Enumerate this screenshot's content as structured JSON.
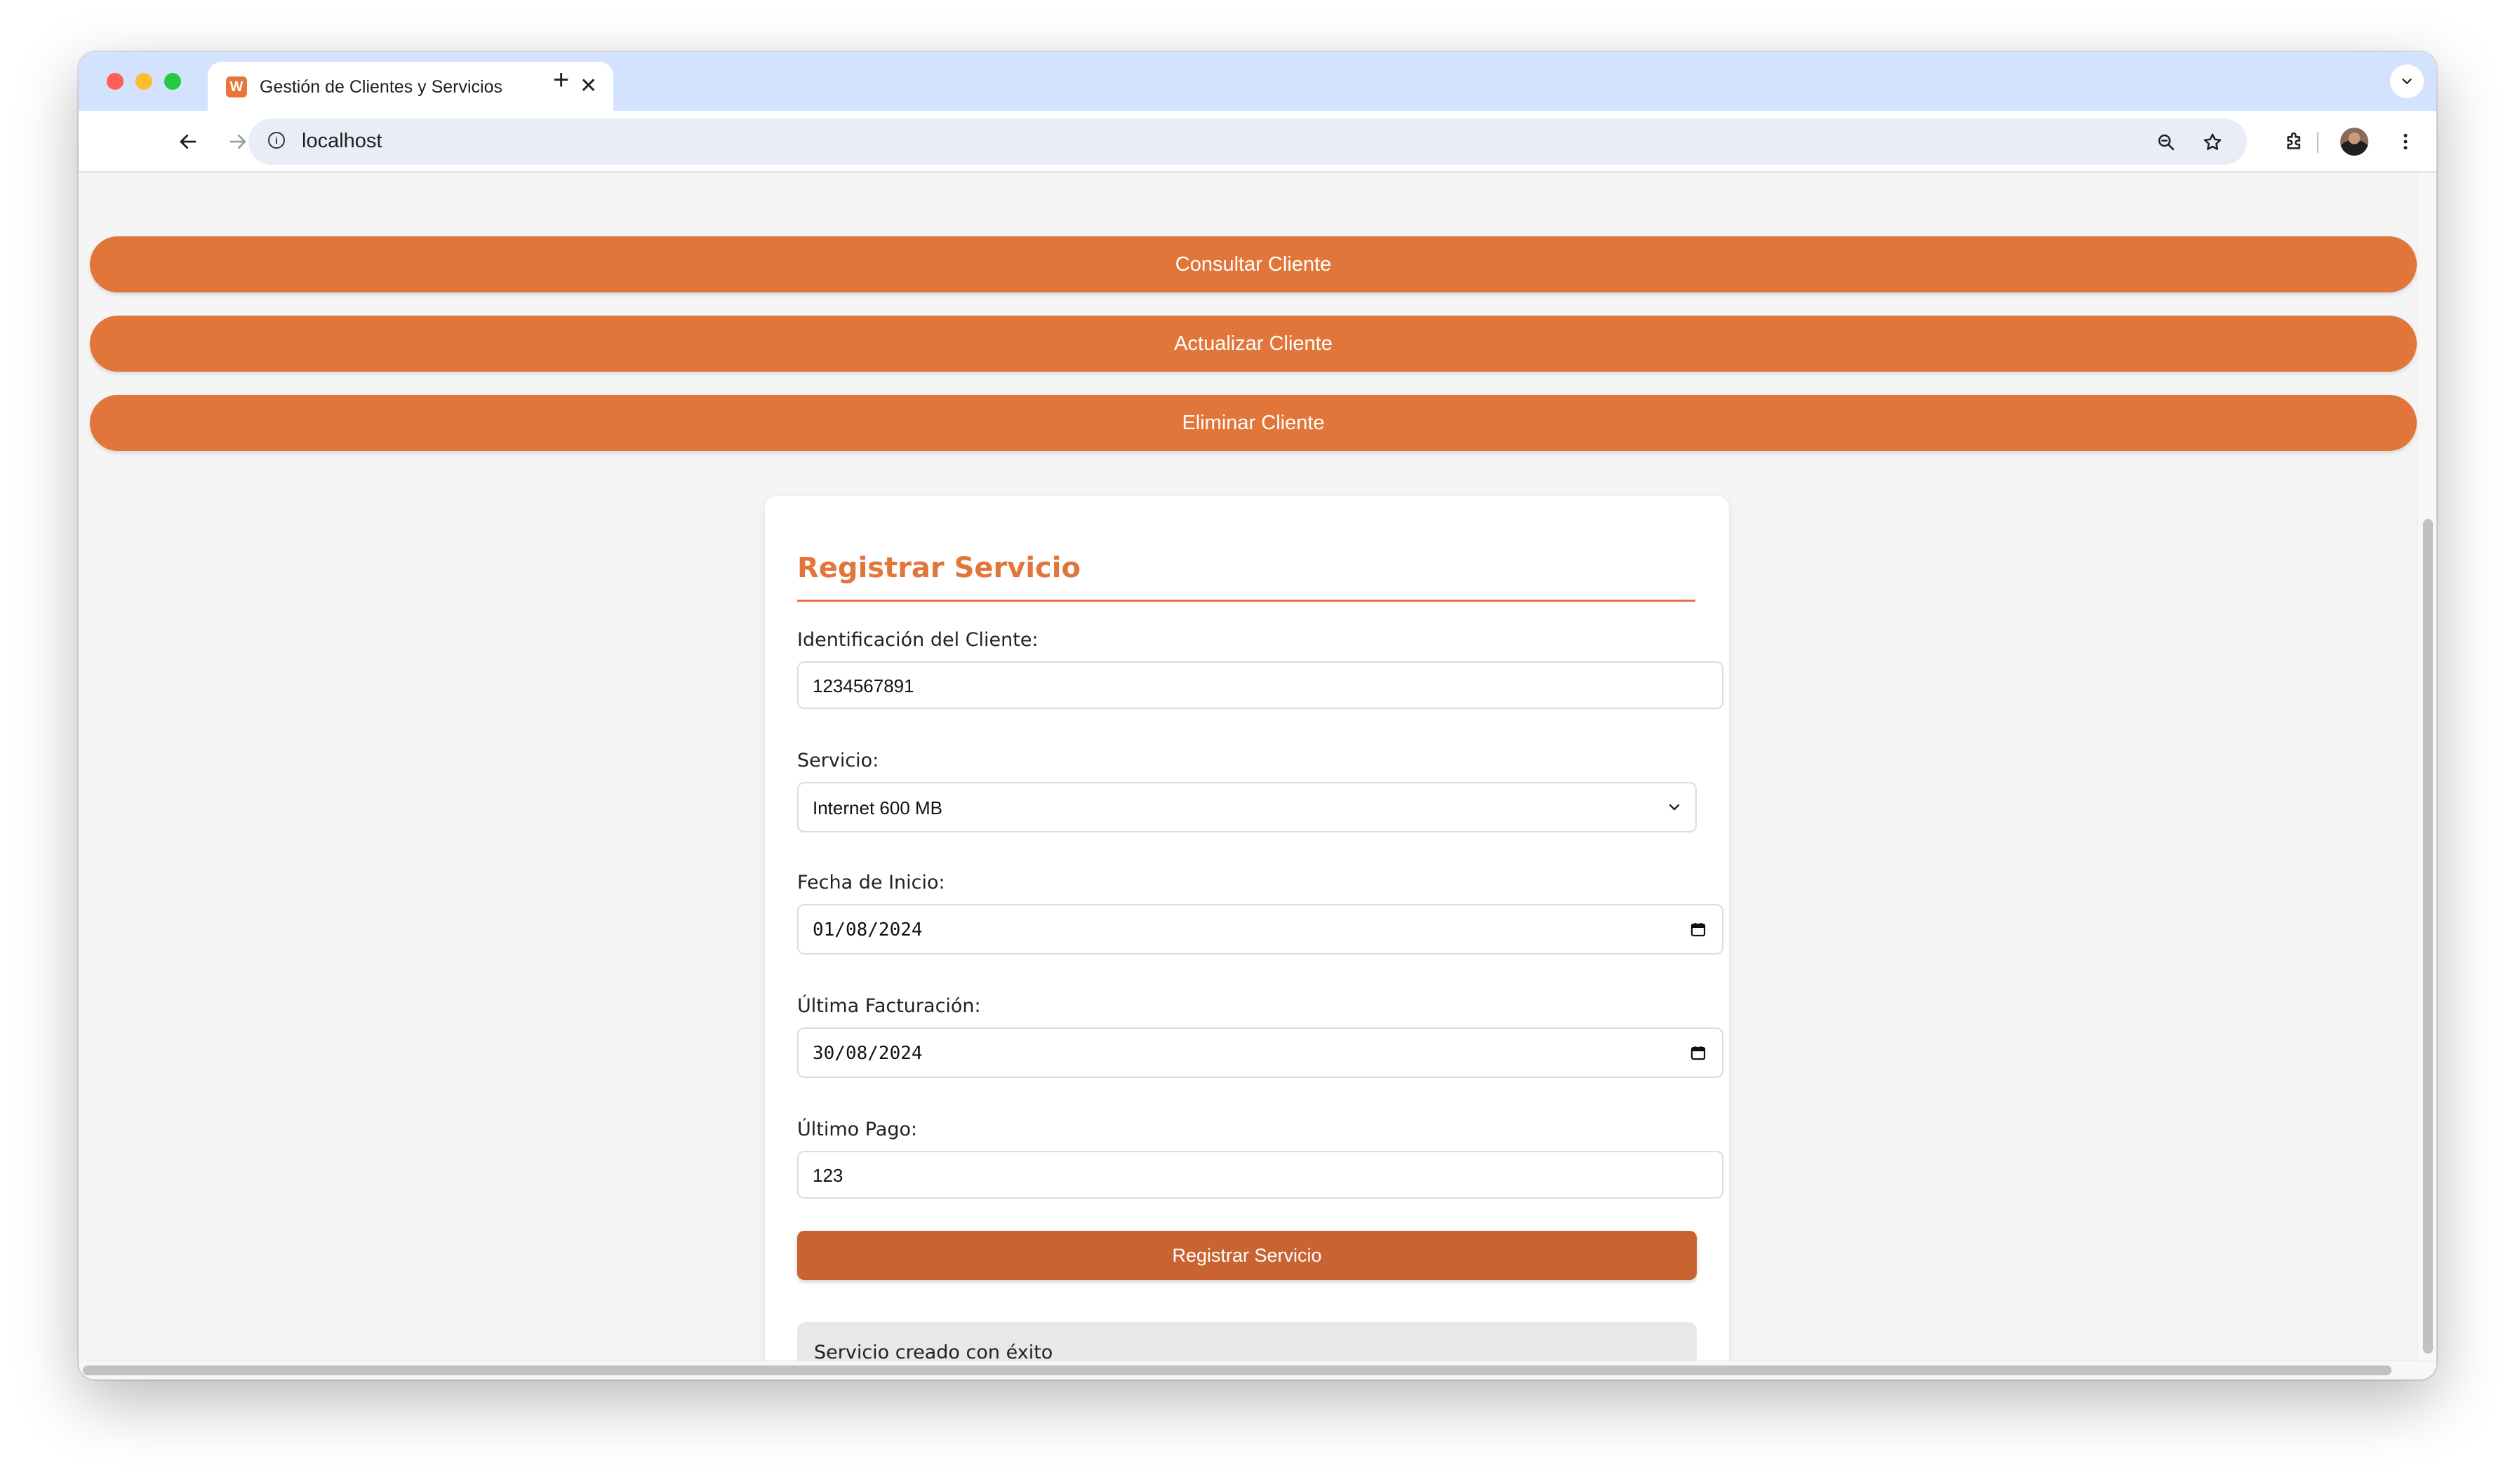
{
  "browser": {
    "tab_title": "Gestión de Clientes y Servicios",
    "tab_favicon": "W",
    "close_glyph": "✕",
    "newtab_glyph": "+",
    "url": "localhost",
    "info_glyph": "i",
    "icons": [
      "back-icon",
      "forward-icon",
      "reload-icon",
      "zoom-icon",
      "bookmark-star-icon",
      "extensions-icon",
      "avatar",
      "menu-icon",
      "tab-search-chevron-icon"
    ]
  },
  "actions": {
    "consultar": "Consultar Cliente",
    "actualizar": "Actualizar Cliente",
    "eliminar": "Eliminar Cliente"
  },
  "form": {
    "title": "Registrar Servicio",
    "cliente_label": "Identificación del Cliente:",
    "cliente_value": "1234567891",
    "servicio_label": "Servicio:",
    "servicio_value": "Internet 600 MB",
    "fecha_inicio_label": "Fecha de Inicio:",
    "fecha_inicio_value": "01/08/2024",
    "ultima_facturacion_label": "Última Facturación:",
    "ultima_facturacion_value": "30/08/2024",
    "ultimo_pago_label": "Último Pago:",
    "ultimo_pago_value": "123",
    "submit_label": "Registrar Servicio"
  },
  "result": {
    "message": "Servicio creado con éxito"
  },
  "colors": {
    "accent": "#e2763a",
    "submit": "#c96332",
    "tab_strip": "#d3e3fd",
    "page_bg": "#f5f5f5"
  }
}
